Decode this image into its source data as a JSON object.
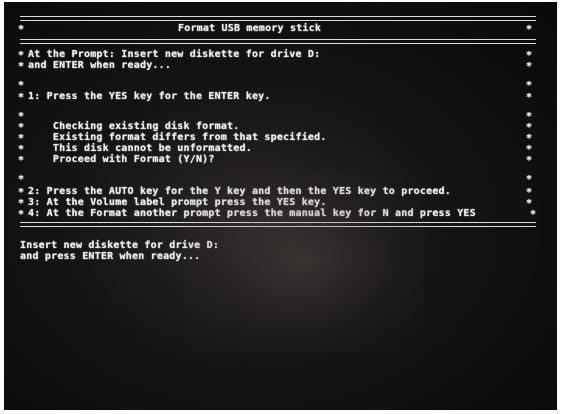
{
  "screen": {
    "title": "Format USB memory stick",
    "border_char": "*",
    "instructions": [
      "At the Prompt: Insert new diskette for drive D:",
      "and ENTER when ready...",
      "",
      "1: Press the YES key for the ENTER key.",
      "",
      "    Checking existing disk format.",
      "    Existing format differs from that specified.",
      "    This disk cannot be unformatted.",
      "    Proceed with Format (Y/N)?",
      "",
      "2: Press the AUTO key for the Y key and then the YES key to proceed.",
      "3: At the Volume label prompt press the YES key.",
      "4: At the Format another prompt press the manual key for N and press YES"
    ],
    "prompt": [
      "Insert new diskette for drive D:",
      "and press ENTER when ready..."
    ]
  }
}
